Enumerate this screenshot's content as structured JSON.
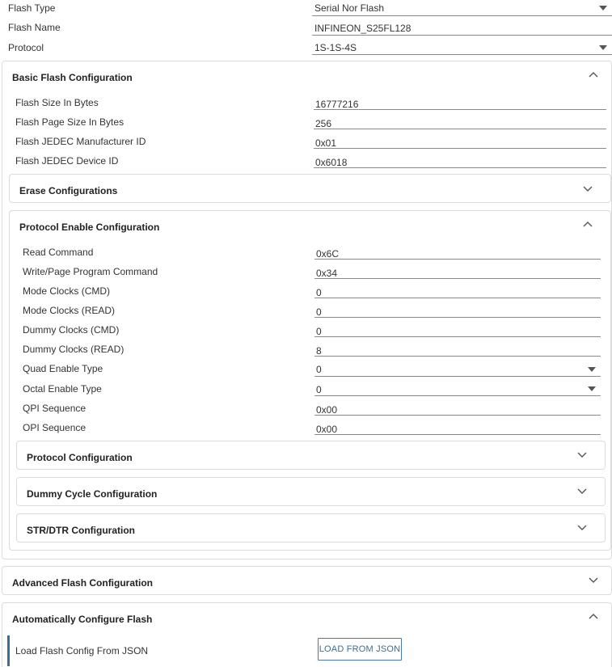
{
  "top": {
    "flash_type_label": "Flash Type",
    "flash_type_value": "Serial Nor Flash",
    "flash_name_label": "Flash Name",
    "flash_name_value": "INFINEON_S25FL128",
    "protocol_label": "Protocol",
    "protocol_value": "1S-1S-4S"
  },
  "basic": {
    "title": "Basic Flash Configuration",
    "fields": [
      {
        "label": "Flash Size In Bytes",
        "value": "16777216"
      },
      {
        "label": "Flash Page Size In Bytes",
        "value": "256"
      },
      {
        "label": "Flash JEDEC Manufacturer ID",
        "value": "0x01"
      },
      {
        "label": "Flash JEDEC Device ID",
        "value": "0x6018"
      }
    ],
    "erase_title": "Erase Configurations",
    "protocol_enable": {
      "title": "Protocol Enable Configuration",
      "fields": [
        {
          "label": "Read Command",
          "value": "0x6C"
        },
        {
          "label": "Write/Page Program Command",
          "value": "0x34"
        },
        {
          "label": "Mode Clocks (CMD)",
          "value": "0"
        },
        {
          "label": "Mode Clocks (READ)",
          "value": "0"
        },
        {
          "label": "Dummy Clocks (CMD)",
          "value": "0"
        },
        {
          "label": "Dummy Clocks (READ)",
          "value": "8"
        },
        {
          "label": "Quad Enable Type",
          "value": "0"
        },
        {
          "label": "Octal Enable Type",
          "value": "0"
        },
        {
          "label": "QPI Sequence",
          "value": "0x00"
        },
        {
          "label": "OPI Sequence",
          "value": "0x00"
        }
      ],
      "sub_panels": [
        {
          "title": "Protocol Configuration"
        },
        {
          "title": "Dummy Cycle Configuration"
        },
        {
          "title": "STR/DTR Configuration"
        }
      ]
    }
  },
  "advanced": {
    "title": "Advanced Flash Configuration"
  },
  "auto": {
    "title": "Automatically Configure Flash",
    "load_label": "Load Flash Config From JSON",
    "load_button": "LOAD FROM JSON"
  },
  "colors": {
    "accent": "#3b6e94",
    "border": "#dcdcdc",
    "underline": "#8a8a8a"
  },
  "icons": {
    "expand": "chevron-down-icon",
    "collapse": "chevron-up-icon",
    "dropdown": "caret-down-icon"
  }
}
